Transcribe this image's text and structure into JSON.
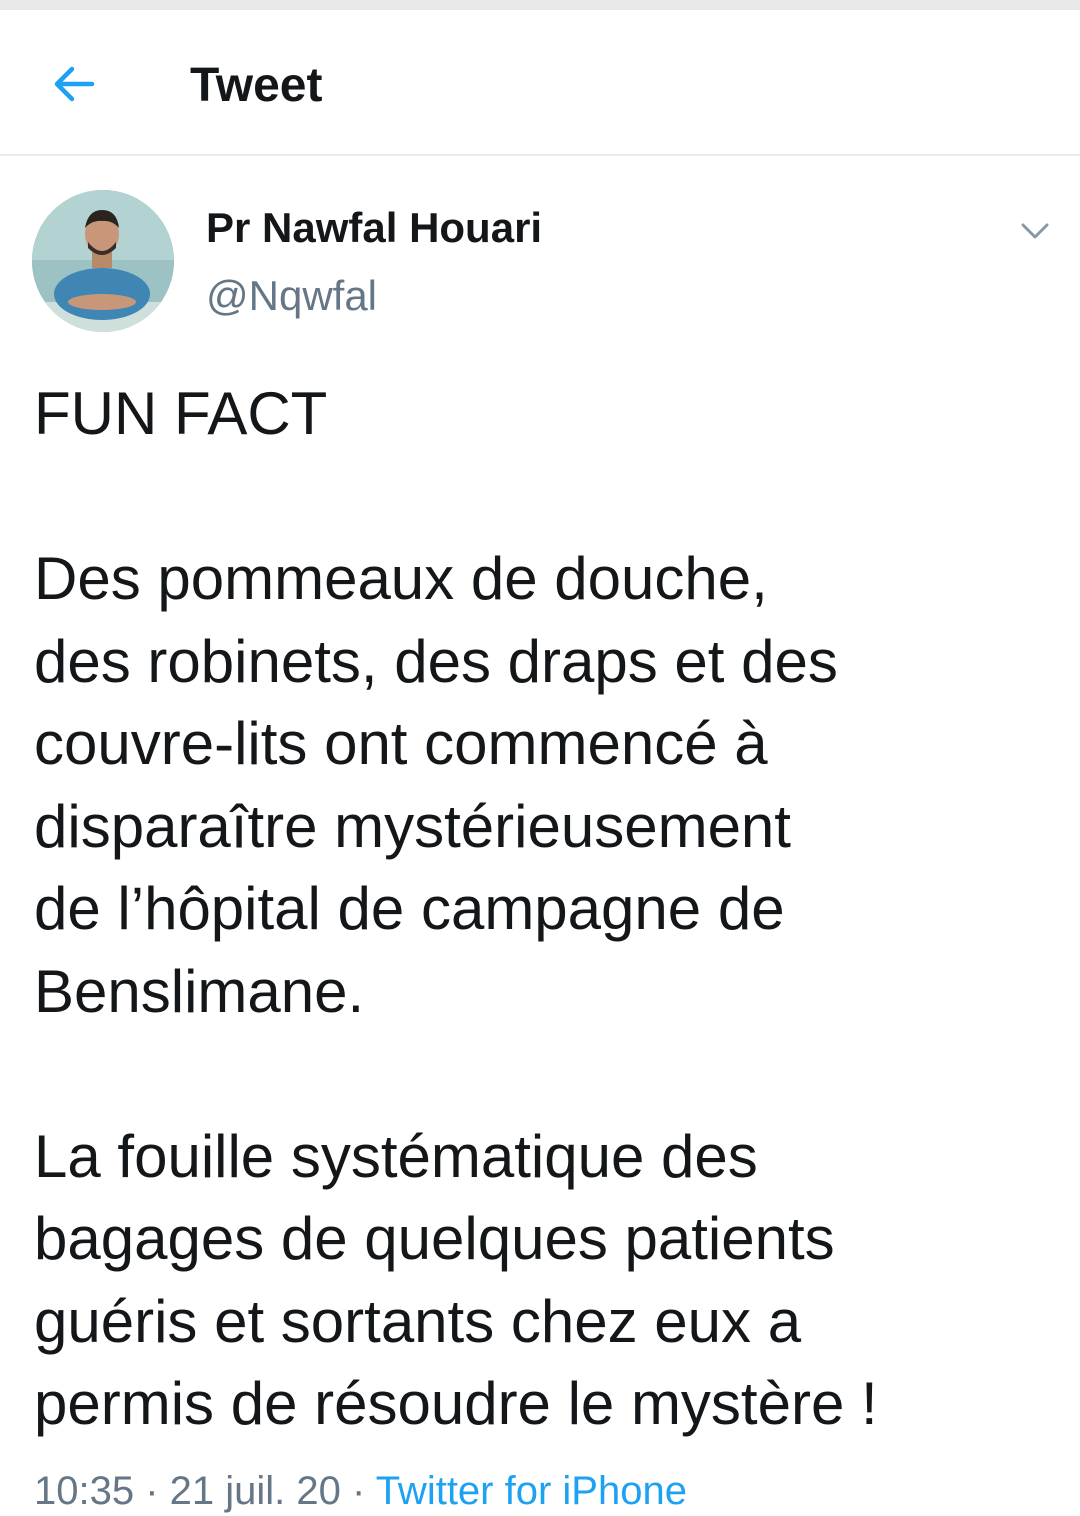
{
  "header": {
    "title": "Tweet",
    "back_icon": "arrow-left-icon",
    "accent_color": "#1da1f2"
  },
  "tweet": {
    "author": {
      "display_name": "Pr Nawfal Houari",
      "handle": "@Nqwfal",
      "avatar_icon": "profile-photo"
    },
    "menu_icon": "chevron-down-icon",
    "text": "FUN FACT\n\nDes pommeaux de douche,\ndes robinets, des draps et des\ncouvre-lits ont commencé à\ndisparaître mystérieusement\nde l’hôpital de campagne de\nBenslimane.\n\nLa fouille systématique des\nbagages de quelques patients\nguéris et sortants chez eux a\npermis de résoudre le mystère !",
    "meta": {
      "time_date": "10:35 · 21 juil. 20 · ",
      "source": "Twitter for iPhone"
    }
  },
  "colors": {
    "text_primary": "#14171a",
    "text_secondary": "#657786",
    "divider": "#e6ecf0"
  }
}
